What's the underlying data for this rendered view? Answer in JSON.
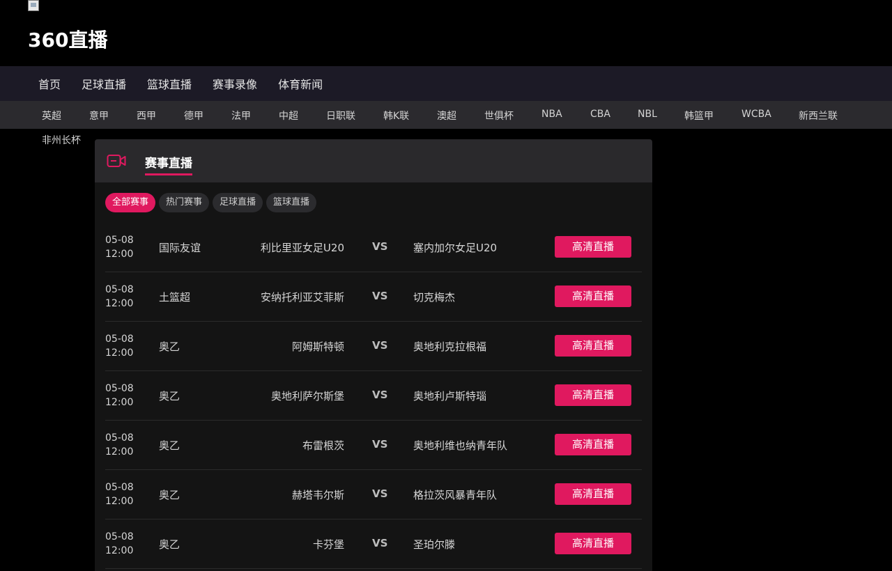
{
  "site": {
    "title": "360直播"
  },
  "nav": {
    "items": [
      "首页",
      "足球直播",
      "篮球直播",
      "赛事录像",
      "体育新闻"
    ]
  },
  "leagues": {
    "items": [
      "英超",
      "意甲",
      "西甲",
      "德甲",
      "法甲",
      "中超",
      "日职联",
      "韩K联",
      "澳超",
      "世俱杯",
      "NBA",
      "CBA",
      "NBL",
      "韩篮甲",
      "WCBA",
      "新西兰联"
    ],
    "overflow": "非州长杯"
  },
  "panel": {
    "title": "赛事直播",
    "filters": [
      "全部赛事",
      "热门赛事",
      "足球直播",
      "篮球直播"
    ],
    "active_filter": "全部赛事"
  },
  "matches": [
    {
      "date": "05-08",
      "time": "12:00",
      "league": "国际友谊",
      "home": "利比里亚女足U20",
      "vs": "VS",
      "away": "塞内加尔女足U20",
      "button": "高清直播"
    },
    {
      "date": "05-08",
      "time": "12:00",
      "league": "土篮超",
      "home": "安纳托利亚艾菲斯",
      "vs": "VS",
      "away": "切克梅杰",
      "button": "高清直播"
    },
    {
      "date": "05-08",
      "time": "12:00",
      "league": "奥乙",
      "home": "阿姆斯特顿",
      "vs": "VS",
      "away": "奥地利克拉根福",
      "button": "高清直播"
    },
    {
      "date": "05-08",
      "time": "12:00",
      "league": "奥乙",
      "home": "奥地利萨尔斯堡",
      "vs": "VS",
      "away": "奥地利卢斯特瑙",
      "button": "高清直播"
    },
    {
      "date": "05-08",
      "time": "12:00",
      "league": "奥乙",
      "home": "布雷根茨",
      "vs": "VS",
      "away": "奥地利维也纳青年队",
      "button": "高清直播"
    },
    {
      "date": "05-08",
      "time": "12:00",
      "league": "奥乙",
      "home": "赫塔韦尔斯",
      "vs": "VS",
      "away": "格拉茨风暴青年队",
      "button": "高清直播"
    },
    {
      "date": "05-08",
      "time": "12:00",
      "league": "奥乙",
      "home": "卡芬堡",
      "vs": "VS",
      "away": "圣珀尔滕",
      "button": "高清直播"
    }
  ],
  "colors": {
    "accent": "#e0195f",
    "background": "#000000",
    "nav_bg": "#1c1a26",
    "league_bar_bg": "#2b2a2e",
    "panel_bg": "#141414",
    "panel_header_bg": "#2a292c"
  },
  "icons": {
    "logo": "broken-image-icon",
    "panel": "video-camera-icon"
  }
}
